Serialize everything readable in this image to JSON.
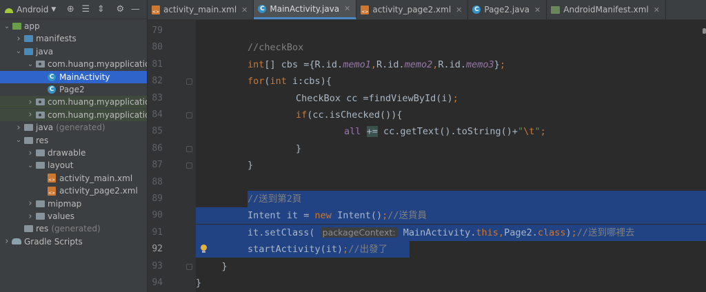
{
  "project_panel": {
    "view_label": "Android",
    "toolbar_icons": [
      "target-icon",
      "collapse-all-icon",
      "expand-icon",
      "gear-icon",
      "minimize-icon"
    ],
    "tree": [
      {
        "label": "app",
        "indent": 0,
        "icon": "app-module",
        "arrow": "v"
      },
      {
        "label": "manifests",
        "indent": 1,
        "icon": "folder-blue",
        "arrow": ">"
      },
      {
        "label": "java",
        "indent": 1,
        "icon": "folder-blue",
        "arrow": "v"
      },
      {
        "label": "com.huang.myapplication",
        "indent": 2,
        "icon": "package",
        "arrow": "v"
      },
      {
        "label": "MainActivity",
        "indent": 3,
        "icon": "class",
        "arrow": "",
        "selected": true
      },
      {
        "label": "Page2",
        "indent": 3,
        "icon": "class",
        "arrow": ""
      },
      {
        "label": "com.huang.myapplication",
        "indent": 2,
        "icon": "package",
        "arrow": ">",
        "changed": true,
        "suffix": ""
      },
      {
        "label": "com.huang.myapplication",
        "indent": 2,
        "icon": "package",
        "arrow": ">",
        "changed": true,
        "suffix": ""
      },
      {
        "label": "java",
        "indent": 1,
        "icon": "folder-gen",
        "arrow": ">",
        "suffix": "(generated)"
      },
      {
        "label": "res",
        "indent": 1,
        "icon": "folder",
        "arrow": "v"
      },
      {
        "label": "drawable",
        "indent": 2,
        "icon": "folder",
        "arrow": ">"
      },
      {
        "label": "layout",
        "indent": 2,
        "icon": "folder",
        "arrow": "v"
      },
      {
        "label": "activity_main.xml",
        "indent": 3,
        "icon": "xml",
        "arrow": ""
      },
      {
        "label": "activity_page2.xml",
        "indent": 3,
        "icon": "xml",
        "arrow": ""
      },
      {
        "label": "mipmap",
        "indent": 2,
        "icon": "folder",
        "arrow": ">"
      },
      {
        "label": "values",
        "indent": 2,
        "icon": "folder",
        "arrow": ">"
      },
      {
        "label": "res",
        "indent": 1,
        "icon": "folder-gen",
        "arrow": "",
        "suffix": "(generated)"
      },
      {
        "label": "Gradle Scripts",
        "indent": 0,
        "icon": "gradle",
        "arrow": ">"
      }
    ]
  },
  "tabs": [
    {
      "label": "activity_main.xml",
      "icon": "xml"
    },
    {
      "label": "MainActivity.java",
      "icon": "class",
      "active": true
    },
    {
      "label": "activity_page2.xml",
      "icon": "xml"
    },
    {
      "label": "Page2.java",
      "icon": "class"
    },
    {
      "label": "AndroidManifest.xml",
      "icon": "manifest"
    }
  ],
  "editor": {
    "current_line": 92,
    "lines": [
      {
        "no": "79",
        "html": ""
      },
      {
        "no": "80",
        "html": "<span class=\"cm\">//checkBox</span>"
      },
      {
        "no": "81",
        "html": "<span class=\"kw\">int</span>[] cbs ={R.id.<span class=\"fld\">memo1</span><span class=\"kw\">,</span>R.id.<span class=\"fld\">memo2</span><span class=\"kw\">,</span>R.id.<span class=\"fld\">memo3</span>}<span class=\"kw\">;</span>"
      },
      {
        "no": "82",
        "html": "<span class=\"kw\">for</span>(<span class=\"kw\">int</span> i:cbs){"
      },
      {
        "no": "83",
        "html": "    CheckBox cc =findViewById(i)<span class=\"kw\">;</span>"
      },
      {
        "no": "84",
        "html": "    <span class=\"kw\">if</span>(cc.isChecked()){"
      },
      {
        "no": "85",
        "html": "        <span class=\"var\">all</span> <span class=\"hl\">+=</span> cc.getText().toString()+<span class=\"str\">\"<span class=\"esc\">\\t</span>\"</span><span class=\"kw\">;</span>"
      },
      {
        "no": "86",
        "html": "    }"
      },
      {
        "no": "87",
        "html": "}"
      },
      {
        "no": "88",
        "html": ""
      },
      {
        "no": "89",
        "html": "<span class=\"cm\">//送到第2頁</span>"
      },
      {
        "no": "90",
        "html": "Intent it = <span class=\"kw\">new</span> Intent()<span class=\"kw\">;</span><span class=\"cm\">//送貨員</span>"
      },
      {
        "no": "91",
        "html": "it.setClass( <span class=\"hint\">packageContext:</span> MainActivity.<span class=\"kw\">this,</span>Page2.<span class=\"kw\">class</span>)<span class=\"kw\">;</span><span class=\"cm\">//送到哪裡去</span>"
      },
      {
        "no": "92",
        "html": "startActivity(it)<span class=\"kw\">;</span><span class=\"cm\">//出發了</span>"
      },
      {
        "no": "93",
        "html": "}"
      },
      {
        "no": "94",
        "html": "}"
      }
    ]
  }
}
